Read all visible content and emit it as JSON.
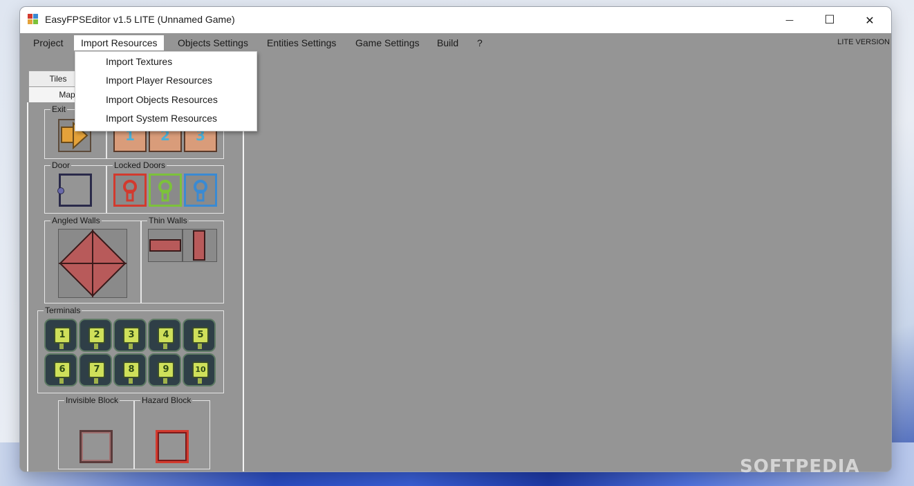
{
  "window": {
    "title": "EasyFPSEditor v1.5 LITE (Unnamed Game)",
    "minimize_glyph": "—",
    "maximize_glyph": "☐",
    "close_glyph": "✕"
  },
  "menu": {
    "items": [
      "Project",
      "Import Resources",
      "Objects Settings",
      "Entities Settings",
      "Game Settings",
      "Build",
      "?"
    ],
    "active_item": "Import Resources",
    "right_label": "LITE VERSION"
  },
  "dropdown": {
    "items": [
      "Import Textures",
      "Import Player Resources",
      "Import Objects Resources",
      "Import System Resources"
    ]
  },
  "tabs": {
    "tiles": "Tiles",
    "map": "Map"
  },
  "groups": {
    "exit": "Exit",
    "door": "Door",
    "locked_doors": "Locked Doors",
    "angled_walls": "Angled Walls",
    "thin_walls": "Thin Walls",
    "terminals": "Terminals",
    "invisible_block": "Invisible Block",
    "hazard_block": "Hazard Block"
  },
  "teleport_labels": [
    "1",
    "2",
    "3"
  ],
  "terminals": [
    "1",
    "2",
    "3",
    "4",
    "5",
    "6",
    "7",
    "8",
    "9",
    "10"
  ],
  "watermark": "SOFTPEDIA",
  "colors": {
    "workspace": "#959595",
    "exit_tile": "#e4a23a",
    "lock_red": "#d23a2e",
    "lock_green": "#7cc23a",
    "lock_blue": "#3a8ad2",
    "wall": "#b85a5a",
    "terminal_screen": "#cfe05a",
    "hazard": "#d23a2e"
  }
}
